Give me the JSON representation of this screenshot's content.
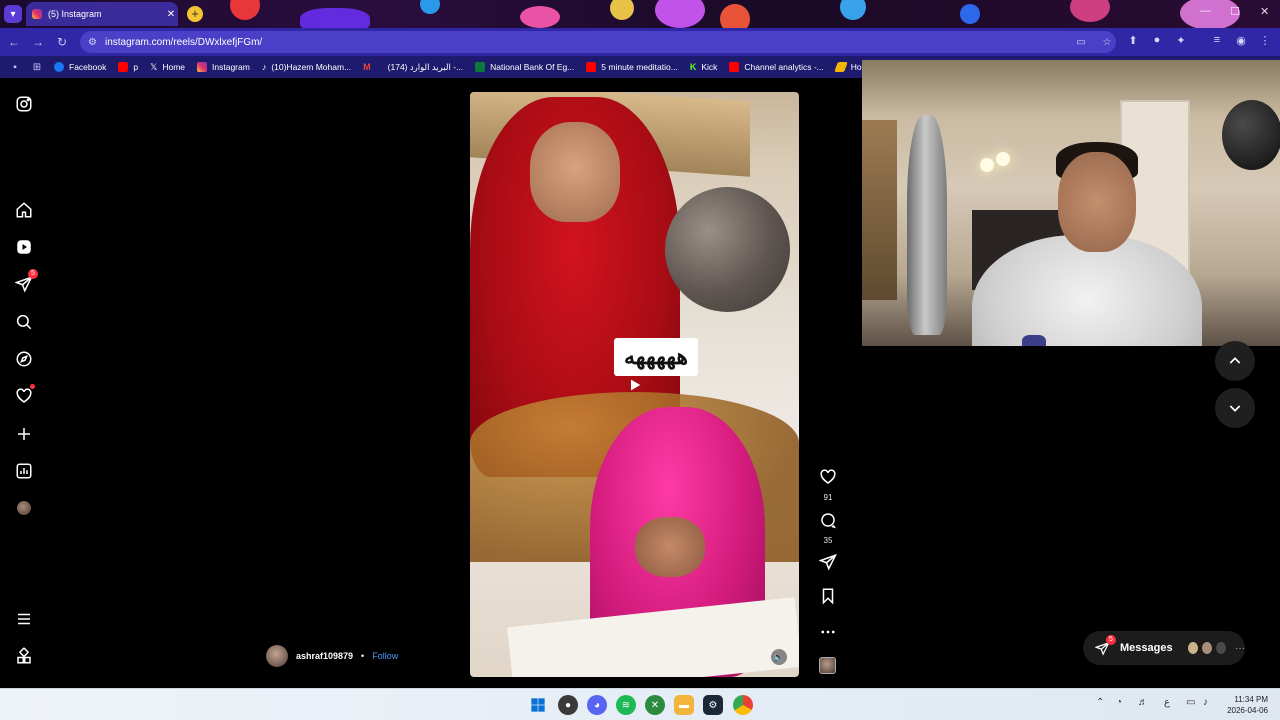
{
  "browser": {
    "tab_title": "(5) Instagram",
    "tab_close": "✕",
    "new_tab": "+",
    "url": "instagram.com/reels/DWxlxefjFGm/",
    "bookmarks": [
      {
        "label": "Facebook",
        "color": "#1877f2"
      },
      {
        "label": "p",
        "color": "#ff0000"
      },
      {
        "label": "Home",
        "color": "#000000"
      },
      {
        "label": "Instagram",
        "color": "#e1306c"
      },
      {
        "label": "(10)Hazem Moham...",
        "color": "#111111"
      },
      {
        "label": "",
        "color": "#ea4335"
      },
      {
        "label": "(174) البريد الوارد -...",
        "color": "#ea4335"
      },
      {
        "label": "National Bank Of Eg...",
        "color": "#0a7a3a"
      },
      {
        "label": "5 minute meditatio...",
        "color": "#ff0000"
      },
      {
        "label": "Kick",
        "color": "#53fc18"
      },
      {
        "label": "Channel analytics -...",
        "color": "#ff0000"
      },
      {
        "label": "Home – G",
        "color": "#f4b400"
      }
    ]
  },
  "sidebar": {
    "notifications_badge": "5"
  },
  "reel": {
    "caption": "هههههه",
    "author": "ashraf109879",
    "separator": "•",
    "follow": "Follow",
    "likes": "91",
    "comments": "35"
  },
  "messages": {
    "label": "Messages",
    "badge": "5",
    "more": "···"
  },
  "taskbar": {
    "time": "11:34 PM",
    "date": "2026-04-06",
    "lang": "ع"
  },
  "colors": {
    "toolbar": "#2f27a6",
    "instagram_accent": "#ff3040",
    "follow_link": "#4a9bff"
  }
}
